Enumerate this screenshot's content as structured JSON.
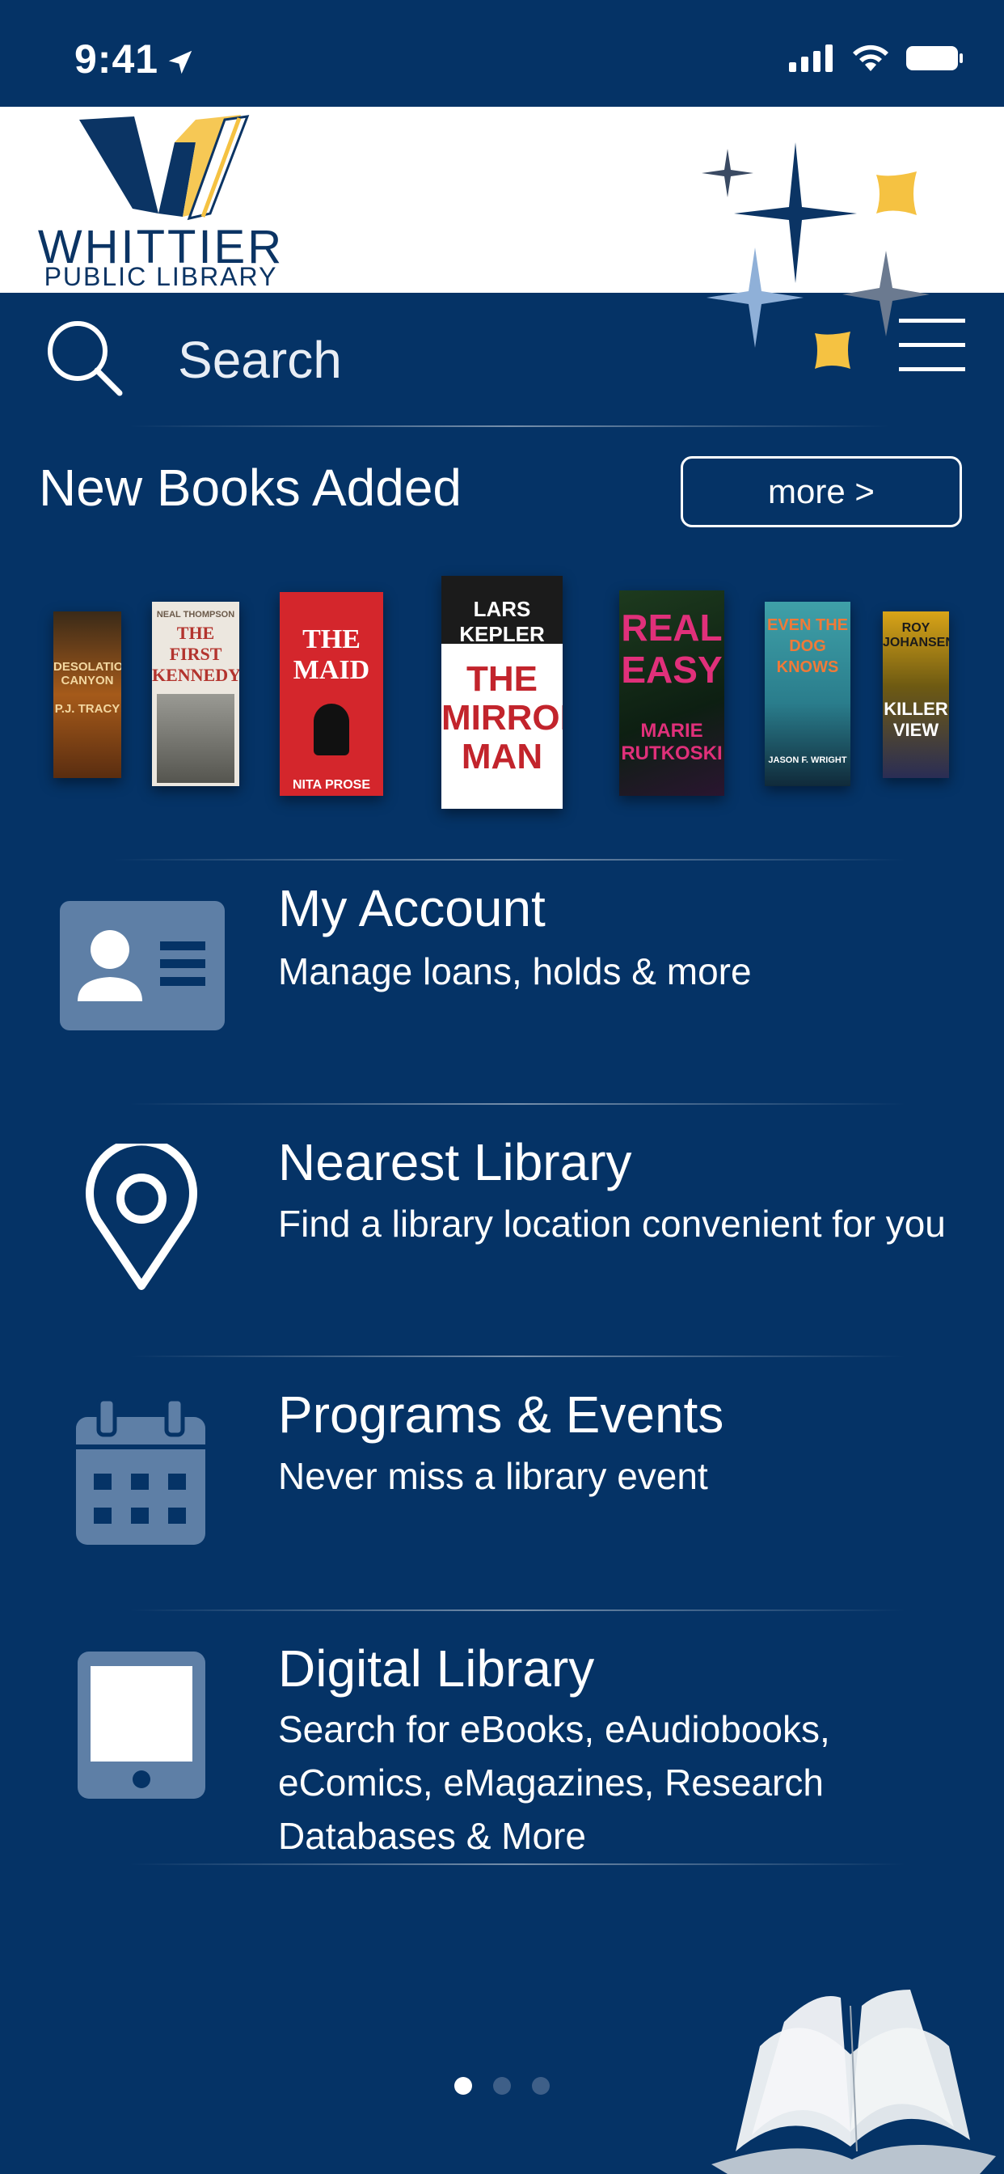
{
  "status_bar": {
    "time": "9:41"
  },
  "header": {
    "logo_title": "WHITTIER",
    "logo_subtitle": "PUBLIC LIBRARY"
  },
  "search": {
    "placeholder": "Search"
  },
  "new_books": {
    "title": "New Books Added",
    "more_label": "more >",
    "books": [
      {
        "title": "DESOLATION CANYON",
        "author": "P.J. TRACY"
      },
      {
        "title": "THE FIRST KENNEDYS",
        "author": "NEAL THOMPSON"
      },
      {
        "title": "THE MAID",
        "author": "NITA PROSE"
      },
      {
        "title": "THE MIRROR MAN",
        "author": "LARS KEPLER"
      },
      {
        "title": "REAL EASY",
        "author": "MARIE RUTKOSKI"
      },
      {
        "title": "EVEN THE DOG KNOWS",
        "author": "JASON F. WRIGHT"
      },
      {
        "title": "KILLER VIEW",
        "author": "ROY JOHANSEN"
      }
    ]
  },
  "menu_items": [
    {
      "title": "My Account",
      "subtitle": "Manage loans, holds & more",
      "icon": "id-card-icon"
    },
    {
      "title": "Nearest Library",
      "subtitle": "Find a library location convenient for you",
      "icon": "map-pin-icon"
    },
    {
      "title": "Programs & Events",
      "subtitle": "Never miss a library event",
      "icon": "calendar-icon"
    },
    {
      "title": "Digital Library",
      "subtitle": "Search for eBooks, eAudiobooks, eComics, eMagazines, Research Databases & More",
      "icon": "tablet-icon"
    }
  ],
  "pagination": {
    "pages": 3,
    "active": 1
  },
  "colors": {
    "background": "#053366",
    "icon": "#5e7fa6",
    "star_gold": "#f5c242",
    "star_navy": "#0b3464"
  }
}
